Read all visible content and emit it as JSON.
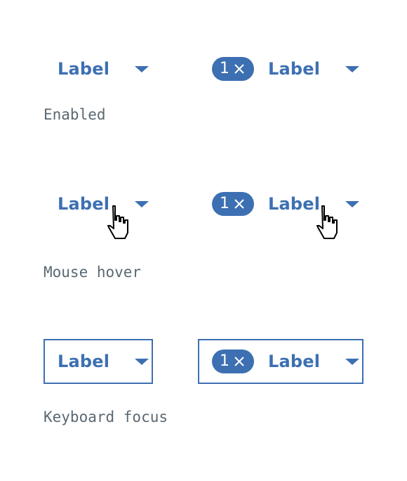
{
  "dropdown": {
    "label": "Label",
    "caret_icon": "caret-down-icon"
  },
  "tag": {
    "count": "1",
    "clear_icon": "close-icon"
  },
  "states": {
    "enabled": "Enabled",
    "hover": "Mouse hover",
    "focus": "Keyboard focus"
  },
  "colors": {
    "accent": "#3d70b2",
    "caption": "#5a6872",
    "tag_text": "#ffffff"
  }
}
